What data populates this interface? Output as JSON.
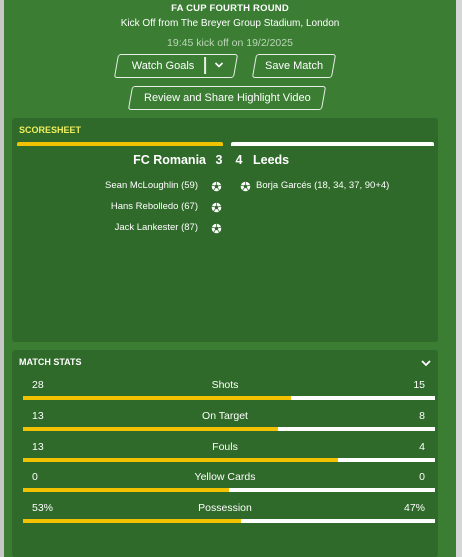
{
  "header": {
    "title": "FA CUP FOURTH ROUND",
    "venue": "Kick Off from The Breyer Group Stadium, London",
    "kickoff": "19:45 kick off on 19/2/2025"
  },
  "buttons": {
    "watch_goals": "Watch Goals",
    "save_match": "Save Match",
    "review_share": "Review and Share Highlight Video"
  },
  "scoresheet": {
    "label": "SCORESHEET",
    "home_team": "FC Romania",
    "away_team": "Leeds",
    "home_score": "3",
    "away_score": "4",
    "home_scorers": [
      "Sean McLoughlin (59)",
      "Hans Rebolledo (67)",
      "Jack Lankester (87)"
    ],
    "away_scorers": [
      "Borja Garcés (18, 34, 37, 90+4)"
    ],
    "home_color": "#f2c200",
    "away_color": "#ffffff"
  },
  "match_stats": {
    "label": "MATCH STATS",
    "rows": [
      {
        "label": "Shots",
        "home": "28",
        "away": "15",
        "home_share": 0.651
      },
      {
        "label": "On Target",
        "home": "13",
        "away": "8",
        "home_share": 0.619
      },
      {
        "label": "Fouls",
        "home": "13",
        "away": "4",
        "home_share": 0.765
      },
      {
        "label": "Yellow Cards",
        "home": "0",
        "away": "0",
        "home_share": 0.5
      },
      {
        "label": "Possession",
        "home": "53%",
        "away": "47%",
        "home_share": 0.53
      }
    ]
  }
}
